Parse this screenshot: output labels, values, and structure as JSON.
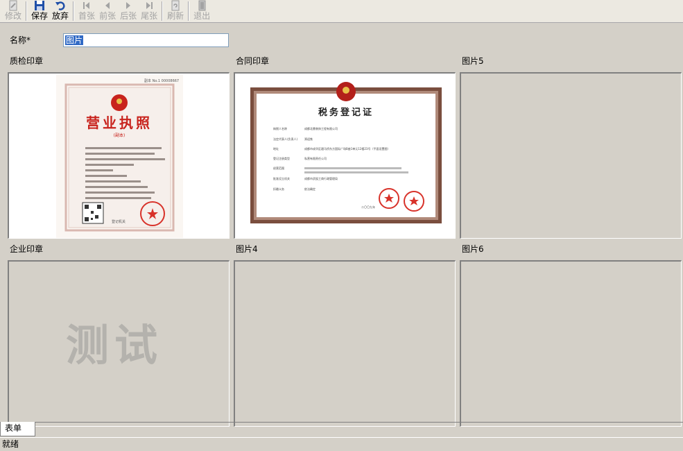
{
  "toolbar": {
    "buttons": [
      {
        "label": "修改",
        "enabled": false
      },
      {
        "label": "保存",
        "enabled": true
      },
      {
        "label": "放弃",
        "enabled": true
      },
      {
        "label": "首张",
        "enabled": false
      },
      {
        "label": "前张",
        "enabled": false
      },
      {
        "label": "后张",
        "enabled": false
      },
      {
        "label": "尾张",
        "enabled": false
      },
      {
        "label": "刷新",
        "enabled": false
      },
      {
        "label": "退出",
        "enabled": false
      }
    ]
  },
  "form": {
    "name_label": "名称*",
    "name_value": "图片"
  },
  "panels": [
    {
      "label": "质检印章"
    },
    {
      "label": "合同印章"
    },
    {
      "label": "图片5"
    },
    {
      "label": "企业印章",
      "watermark": "测试"
    },
    {
      "label": "图片4"
    },
    {
      "label": "图片6"
    }
  ],
  "license_doc": {
    "serial": "副本 No.1 00008667",
    "title": "营业执照",
    "subtitle": "(副本)",
    "footer": "登记机关"
  },
  "tax_doc": {
    "title": "税务登记证",
    "date": "二〇〇九年",
    "rows": [
      {
        "label": "纳税人名称",
        "value": "成都北鼎装饰工程有限公司"
      },
      {
        "label": "法定代表人(负责人)",
        "value": "郑迎铁"
      },
      {
        "label": "地址",
        "value": "成都市成华区驷马桥东方国际广场B座1单元12楼23号（平面设置图）"
      },
      {
        "label": "登记注册类型",
        "value": "私营有限责任公司"
      },
      {
        "label": "经营范围",
        "value": ""
      },
      {
        "label": "批准设立机关",
        "value": "成都市武侯工商行政管理局"
      },
      {
        "label": "扣缴义务",
        "value": "依法确定"
      }
    ]
  },
  "tabs": [
    {
      "label": "表单"
    }
  ],
  "status": {
    "text": "就绪"
  },
  "colors": {
    "background": "#d4d0c8",
    "selection": "#316ac5",
    "toolbar_icon": "#1f4fa8"
  }
}
